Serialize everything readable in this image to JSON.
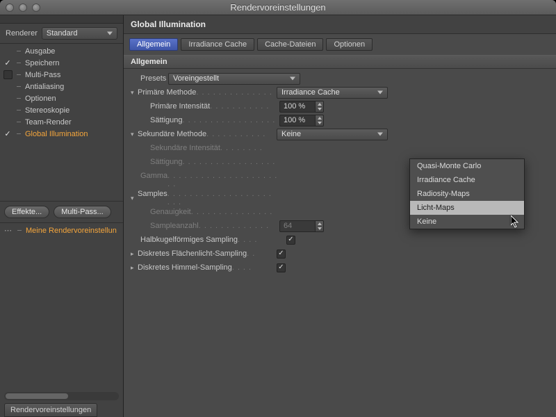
{
  "window": {
    "title": "Rendervoreinstellungen"
  },
  "sidebar": {
    "renderer_label": "Renderer",
    "renderer_value": "Standard",
    "items": [
      {
        "label": "Ausgabe",
        "checked": "",
        "selected": false
      },
      {
        "label": "Speichern",
        "checked": "✓",
        "selected": false
      },
      {
        "label": "Multi-Pass",
        "checked": "□",
        "selected": false
      },
      {
        "label": "Antialiasing",
        "checked": "",
        "selected": false
      },
      {
        "label": "Optionen",
        "checked": "",
        "selected": false
      },
      {
        "label": "Stereoskopie",
        "checked": "",
        "selected": false
      },
      {
        "label": "Team-Render",
        "checked": "",
        "selected": false
      },
      {
        "label": "Global Illumination",
        "checked": "✓",
        "selected": true
      }
    ],
    "buttons": {
      "effects": "Effekte...",
      "multipass": "Multi-Pass..."
    },
    "preset_item": "Meine Rendervoreinstellun",
    "footer_tab": "Rendervoreinstellungen"
  },
  "main": {
    "panel_title": "Global Illumination",
    "tabs": [
      {
        "label": "Allgemein",
        "active": true
      },
      {
        "label": "Irradiance Cache",
        "active": false
      },
      {
        "label": "Cache-Dateien",
        "active": false
      },
      {
        "label": "Optionen",
        "active": false
      }
    ],
    "section1": "Allgemein",
    "presets_label": "Presets",
    "presets_value": "Voreingestellt",
    "primary_method_label": "Primäre Methode",
    "primary_method_value": "Irradiance Cache",
    "primary_intensity_label": "Primäre Intensität",
    "primary_intensity_value": "100 %",
    "primary_saturation_label": "Sättigung",
    "primary_saturation_value": "100 %",
    "secondary_method_label": "Sekundäre Methode",
    "secondary_method_value": "Keine",
    "secondary_intensity_label": "Sekundäre Intensität",
    "secondary_saturation_label": "Sättigung",
    "gamma_label": "Gamma",
    "samples_label": "Samples",
    "accuracy_label": "Genauigkeit",
    "samplecount_label": "Sampleanzahl",
    "samplecount_value": "64",
    "hemi_label": "Halbkugelförmiges Sampling",
    "discrete_area_label": "Diskretes Flächenlicht-Sampling",
    "discrete_sky_label": "Diskretes Himmel-Sampling"
  },
  "dropdown": {
    "items": [
      "Quasi-Monte Carlo",
      "Irradiance Cache",
      "Radiosity-Maps",
      "Licht-Maps",
      "Keine"
    ],
    "highlighted_index": 3
  }
}
